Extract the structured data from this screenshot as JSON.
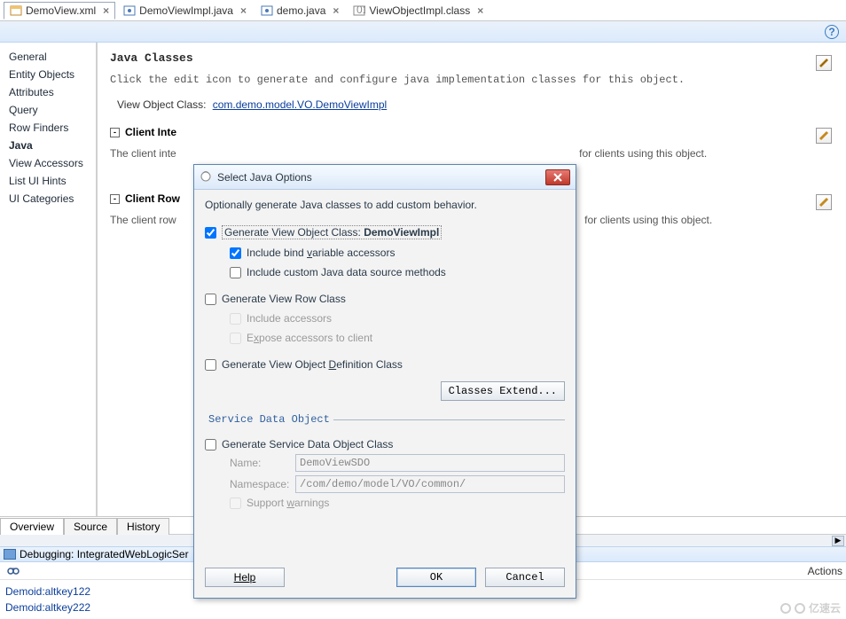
{
  "tabs": [
    {
      "label": "DemoView.xml",
      "active": true
    },
    {
      "label": "DemoViewImpl.java",
      "active": false
    },
    {
      "label": "demo.java",
      "active": false
    },
    {
      "label": "ViewObjectImpl.class",
      "active": false
    }
  ],
  "tab_close_glyph": "×",
  "help_glyph": "?",
  "nav": {
    "items": [
      "General",
      "Entity Objects",
      "Attributes",
      "Query",
      "Row Finders",
      "Java",
      "View Accessors",
      "List UI Hints",
      "UI Categories"
    ],
    "active_index": 5
  },
  "content": {
    "heading": "Java Classes",
    "desc": "Click the edit icon to generate and configure java implementation classes for this object.",
    "view_object_class_label": "View Object Class:",
    "view_object_class_link": "com.demo.model.VO.DemoViewImpl",
    "s1": {
      "title": "Client Inte",
      "collapse": "-",
      "desc": "The client inte",
      "desc_tail": "for clients using this object."
    },
    "s2": {
      "title": "Client Row",
      "collapse": "-",
      "desc": "The client row",
      "desc_tail": " for clients using this object."
    }
  },
  "subtabs": [
    "Overview",
    "Source",
    "History"
  ],
  "debug_label": "Debugging: IntegratedWebLogicSer",
  "actions_label": "Actions",
  "log_lines": [
    "Demoid:altkey122",
    "Demoid:altkey222"
  ],
  "scroll_right_glyph": "▶",
  "dialog": {
    "title": "Select Java Options",
    "intro": "Optionally generate Java classes to add custom behavior.",
    "gen_vo_pre": "Generate View Object Class: ",
    "gen_vo_class": "DemoViewImpl",
    "inc_bind_pre": "Include bind ",
    "inc_bind_u": "v",
    "inc_bind_post": "ariable accessors",
    "inc_custom": "Include custom Java data source methods",
    "gen_row": "Generate View Row Class",
    "inc_acc": "Include accessors",
    "expose_pre": "E",
    "expose_u": "x",
    "expose_post": "pose accessors to client",
    "gen_def_pre": "Generate View Object ",
    "gen_def_u": "D",
    "gen_def_post": "efinition Class",
    "classes_extend": "Classes Extend...",
    "sdo_legend": "Service Data Object",
    "gen_sdo": "Generate Service Data Object Class",
    "name_label": "Name:",
    "name_value": "DemoViewSDO",
    "ns_label": "Namespace:",
    "ns_value": "/com/demo/model/VO/common/",
    "support_pre": "Support ",
    "support_u": "w",
    "support_post": "arnings",
    "help": "Help",
    "ok": "OK",
    "cancel": "Cancel"
  },
  "watermark": "亿速云"
}
